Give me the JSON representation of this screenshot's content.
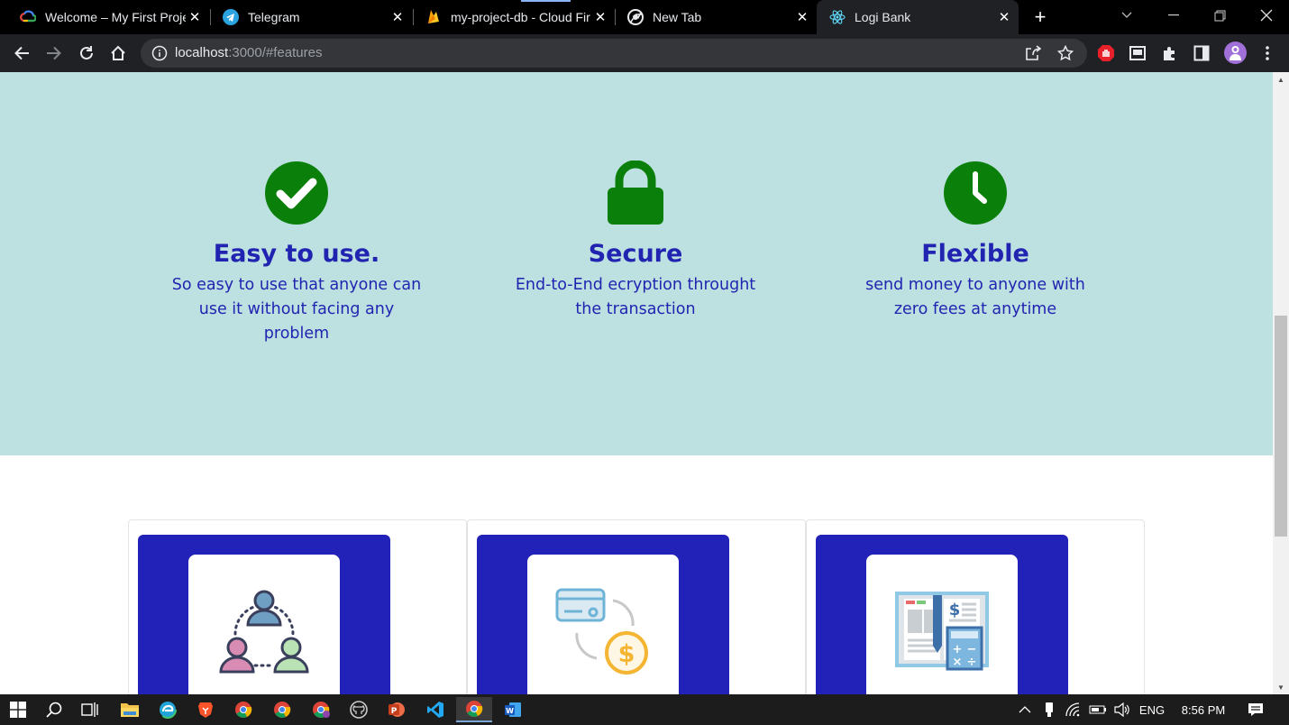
{
  "browser": {
    "tabs": [
      {
        "title": "Welcome – My First Proje",
        "icon": "google-cloud-icon",
        "active": false
      },
      {
        "title": "Telegram",
        "icon": "telegram-icon",
        "active": false
      },
      {
        "title": "my-project-db - Cloud Fir",
        "icon": "firebase-icon",
        "active": false
      },
      {
        "title": "New Tab",
        "icon": "chrome-icon",
        "active": false
      },
      {
        "title": "Logi Bank",
        "icon": "react-icon",
        "active": true
      }
    ],
    "close_glyph": "✕",
    "newtab_glyph": "+",
    "url_host": "localhost",
    "url_rest": ":3000/#features"
  },
  "features": [
    {
      "icon": "check-circle-icon",
      "title": "Easy to use.",
      "description": "So easy to use that anyone can use it without facing any problem"
    },
    {
      "icon": "lock-icon",
      "title": "Secure",
      "description": "End-to-End ecryption throught the transaction"
    },
    {
      "icon": "clock-icon",
      "title": "Flexible",
      "description": "send money to anyone with zero fees at anytime"
    }
  ],
  "cards": [
    {
      "icon": "people-network-icon"
    },
    {
      "icon": "card-to-dollar-icon"
    },
    {
      "icon": "ledger-calculator-icon"
    }
  ],
  "taskbar": {
    "language": "ENG",
    "time": "8:56 PM"
  },
  "colors": {
    "feature_bg": "#bde1e0",
    "feature_text": "#2124b1",
    "icon_green": "#0a7f0a",
    "card_banner": "#2222b8"
  }
}
